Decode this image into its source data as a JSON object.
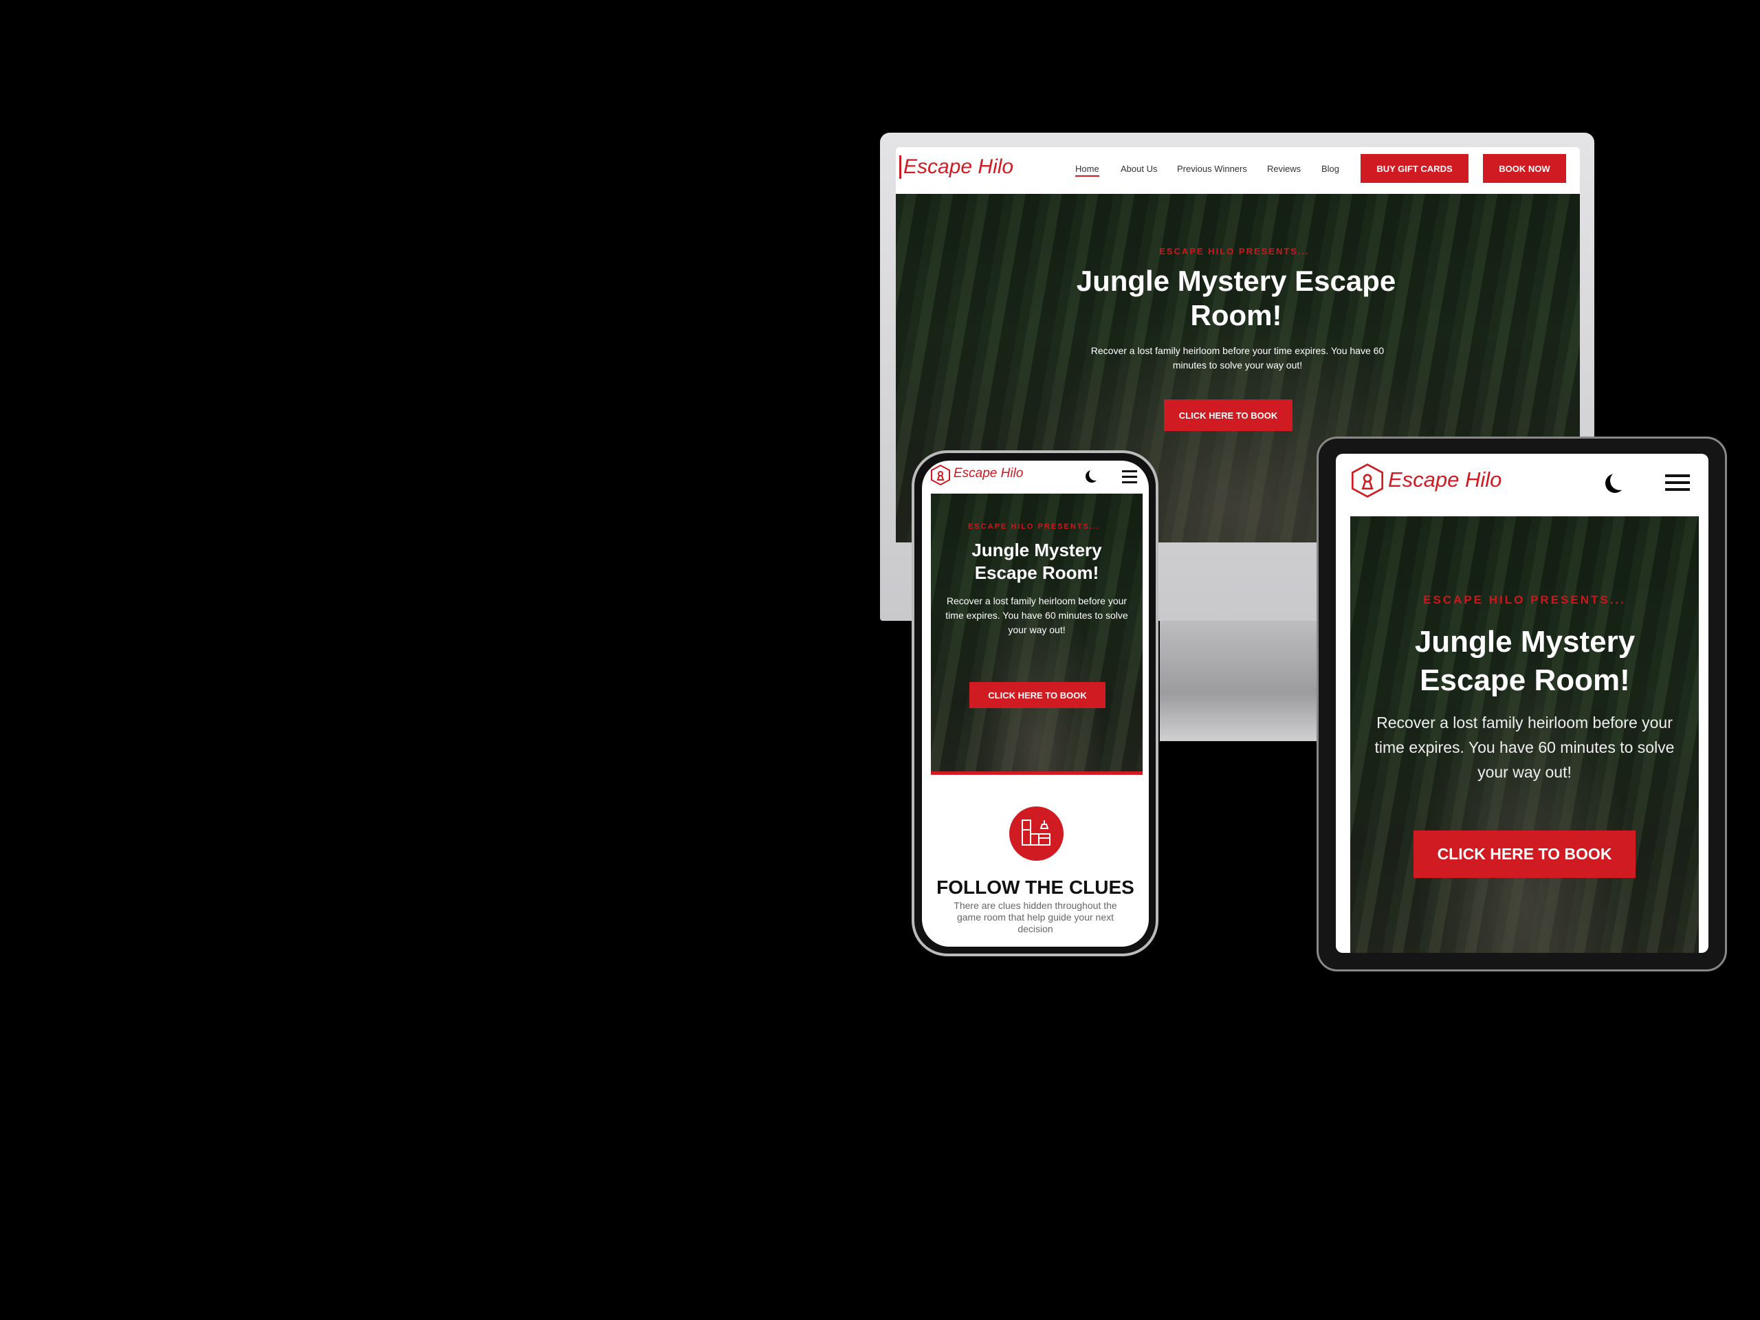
{
  "brand": {
    "name": "Escape Hilo",
    "accent": "#cf1b21"
  },
  "desktop": {
    "nav": [
      {
        "label": "Home",
        "active": true
      },
      {
        "label": "About Us"
      },
      {
        "label": "Previous Winners"
      },
      {
        "label": "Reviews"
      },
      {
        "label": "Blog"
      }
    ],
    "buy_gift_cards": "BUY GIFT CARDS",
    "book_now": "BOOK NOW"
  },
  "hero": {
    "eyebrow": "ESCAPE HILO PRESENTS...",
    "title": "Jungle Mystery Escape Room!",
    "description": "Recover a lost family heirloom before your time expires. You have 60 minutes to solve your way out!",
    "cta": "CLICK HERE TO BOOK"
  },
  "feature": {
    "icon": "kitchen-icon",
    "title": "FOLLOW THE CLUES",
    "description": "There are clues hidden throughout the game room that help guide your next decision"
  },
  "icons": {
    "theme": "moon-icon",
    "menu": "hamburger-menu-icon",
    "logo": "hexagon-keyhole-icon"
  }
}
